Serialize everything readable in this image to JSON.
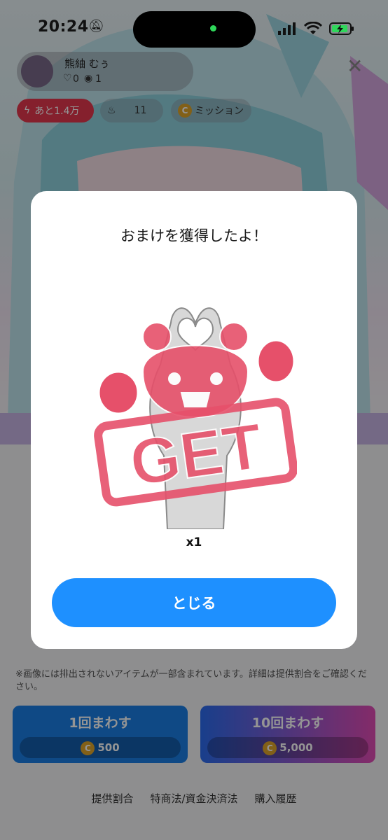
{
  "status_bar": {
    "time": "20:24",
    "battery_icon": "battery-charging-icon"
  },
  "header": {
    "name": "熊紬 むぅ",
    "likes": "0",
    "viewers": "1",
    "chip_remaining": "あと1.4万",
    "chip_fire_count": "11",
    "chip_mission": "ミッション"
  },
  "modal": {
    "title": "おまけを獲得したよ！",
    "quantity": "x1",
    "close_label": "とじる",
    "stamp_text": "GET"
  },
  "disclaimer": "※画像には排出されないアイテムが一部含まれています。詳細は提供割合をご確認ください。",
  "buttons": {
    "single": {
      "label": "1回まわす",
      "price": "500"
    },
    "ten": {
      "label": "10回まわす",
      "price": "5,000"
    }
  },
  "footer_links": [
    "提供割合",
    "特商法/資金決済法",
    "購入履歴"
  ],
  "colors": {
    "primary": "#1e90ff",
    "single_btn": "#1a7ee6",
    "ten_btn_start": "#2b6cf0",
    "ten_btn_end": "#e34bb5",
    "coin": "#e0a52a",
    "stamp": "#e6506a"
  }
}
